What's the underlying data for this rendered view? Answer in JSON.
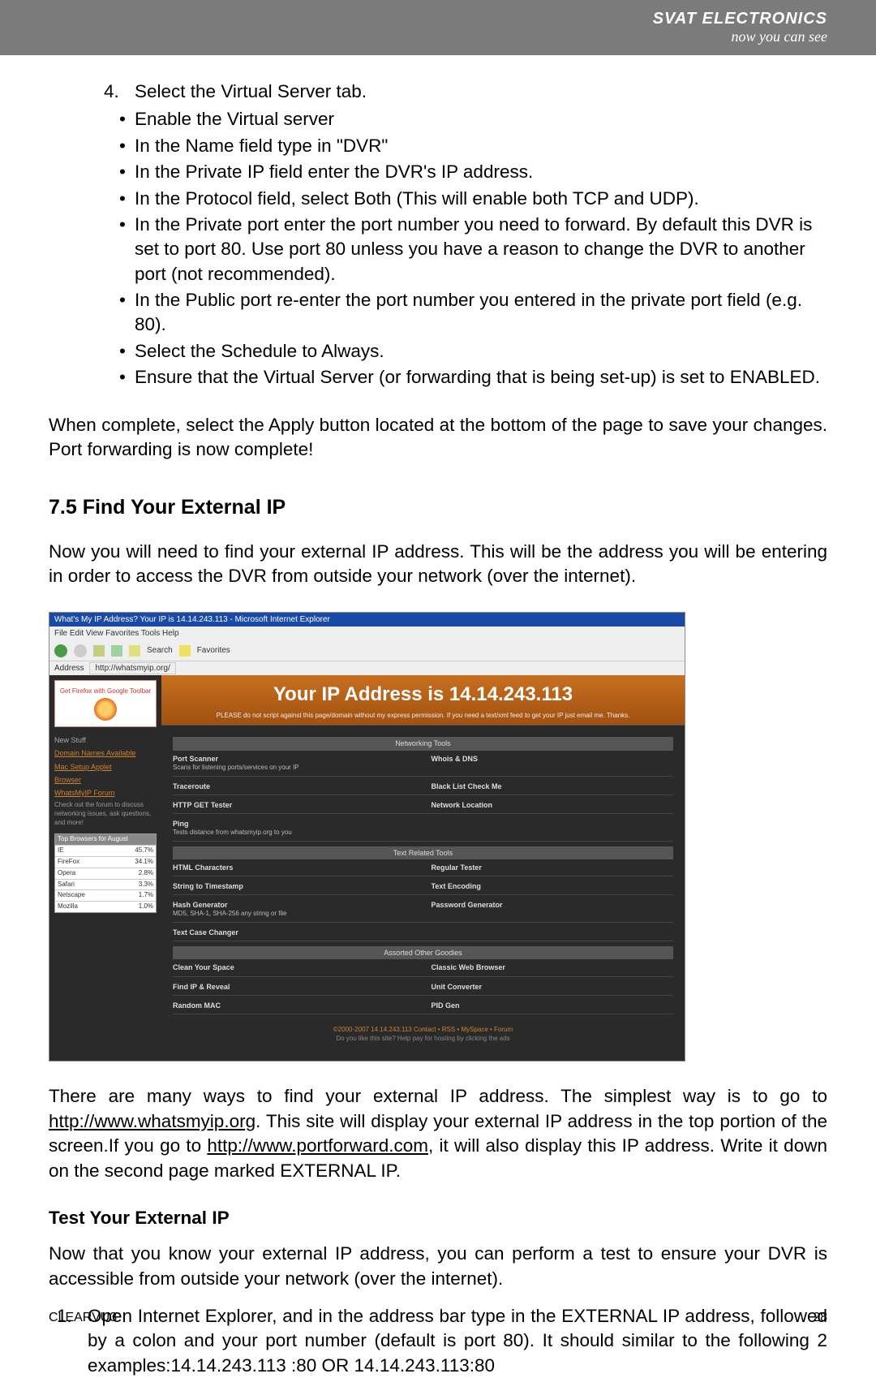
{
  "brand": {
    "top": "SVAT ELECTRONICS",
    "bottom": "now you can see"
  },
  "item4": {
    "num": "4.",
    "text": "Select the Virtual Server tab."
  },
  "bullets": [
    "Enable the Virtual server",
    "In the Name field type in \"DVR\"",
    "In the Private IP field enter the DVR's IP address.",
    "In the Protocol field, select Both (This will enable both TCP and UDP).",
    "In the Private port enter the port number you need to forward. By default this DVR is set to port 80. Use port 80 unless you have a reason to change the DVR to another port (not recommended).",
    "In the Public port re-enter the port number you entered in the private port field (e.g. 80).",
    "Select the Schedule to Always.",
    "Ensure that the Virtual Server (or forwarding that is being set-up) is set to ENABLED."
  ],
  "complete_para": "When complete, select the Apply button located at the bottom of the page to save your changes. Port forwarding is now complete!",
  "section_75": "7.5 Find Your External IP",
  "find_ip_para": "Now you will need to find your external IP address. This will be the address you will be entering in order to access the DVR from outside your network (over the internet).",
  "screenshot": {
    "window_title": "What's My IP Address? Your IP is 14.14.243.113 - Microsoft Internet Explorer",
    "menu": "File  Edit  View  Favorites  Tools  Help",
    "url_label": "Address",
    "url": "http://whatsmyip.org/",
    "ip_banner": "Your IP Address is 14.14.243.113",
    "ip_sub": "PLEASE do not script against this page/domain without my express permission. If you need a text/xml feed to get your IP just email me. Thanks.",
    "ff_text": "Get Firefox with Google Toolbar",
    "side": {
      "h1": "New Stuff",
      "links1": [
        "Domain Names Available",
        "Mac Setup Applet"
      ],
      "h2": "Browser",
      "h3": "WhatsMyIP Forum",
      "desc": "Check out the forum to discuss networking issues, ask questions, and more!",
      "table_h": "Top Browsers for August",
      "rows": [
        [
          "IE",
          "45.7%"
        ],
        [
          "FireFox",
          "34.1%"
        ],
        [
          "Opera",
          "2.8%"
        ],
        [
          "Safari",
          "3.3%"
        ],
        [
          "Netscape",
          "1.7%"
        ],
        [
          "Mozilla",
          "1.0%"
        ]
      ]
    },
    "hdr1": "Networking Tools",
    "hdr2": "Text Related Tools",
    "hdr3": "Assorted Other Goodies",
    "sec1": [
      [
        "Port Scanner",
        "Scans for listening ports/services on your IP"
      ],
      [
        "Whois & DNS",
        ""
      ],
      [
        "Traceroute",
        ""
      ],
      [
        "Black List Check Me",
        ""
      ],
      [
        "HTTP GET Tester",
        ""
      ],
      [
        "Network Location",
        ""
      ],
      [
        "Ping",
        "Tests distance from whatsmyip.org to you"
      ]
    ],
    "sec2": [
      [
        "HTML Characters",
        ""
      ],
      [
        "Regular Tester",
        ""
      ],
      [
        "String to Timestamp",
        ""
      ],
      [
        "Text Encoding",
        ""
      ],
      [
        "Hash Generator",
        "MD5, SHA-1, SHA-256 any string or file"
      ],
      [
        "Password Generator",
        ""
      ],
      [
        "Text Case Changer",
        ""
      ]
    ],
    "sec3": [
      [
        "Clean Your Space",
        ""
      ],
      [
        "Classic Web Browser",
        ""
      ],
      [
        "Find IP & Reveal",
        ""
      ],
      [
        "Unit Converter",
        ""
      ],
      [
        "Random MAC",
        ""
      ],
      [
        "PID Gen",
        ""
      ]
    ],
    "footer": "©2000-2007 14.14.243.113 Contact • RSS • MySpace • Forum",
    "footer2": "Do you like this site? Help pay for hosting by clicking the ads"
  },
  "after_shot": {
    "p1a": "There are many ways to find your external IP address. The simplest way is to go to ",
    "link1": "http://www.whatsmyip.org",
    "p1b": ". This site will display your external IP address in the top portion of the screen.If you go to ",
    "link2": "http://www.portforward.com",
    "p1c": ", it will also display this IP address. Write it down on the second page marked EXTERNAL IP."
  },
  "test_h": "Test Your External IP",
  "test_p": "Now that you know your external IP address, you can perform a test to ensure your DVR is accessible from outside your network (over the internet).",
  "step1": {
    "num": "1.",
    "text": "Open Internet Explorer, and in the address bar type in the EXTERNAL IP address, followed by a colon and your port number (default is port 80). It should similar to the following 2 examples:14.14.243.113 :80 OR 14.14.243.113:80"
  },
  "footer": {
    "left": "CLEARVU3",
    "right": "28"
  }
}
